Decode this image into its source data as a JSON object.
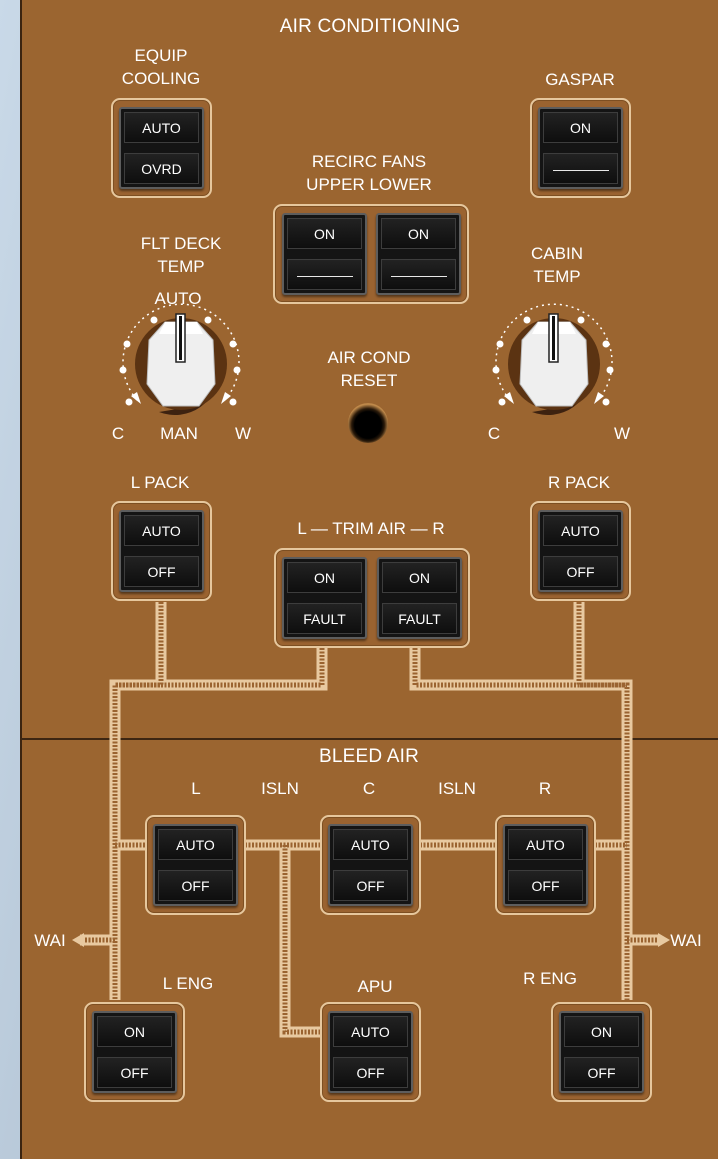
{
  "air_conditioning": {
    "title": "AIR CONDITIONING",
    "equip_cooling": {
      "label": "EQUIP\nCOOLING",
      "top": "AUTO",
      "bottom": "OVRD"
    },
    "gaspar": {
      "label": "GASPAR",
      "top": "ON",
      "bottom": ""
    },
    "recirc_fans": {
      "label": "RECIRC FANS\nUPPER LOWER",
      "upper": {
        "top": "ON",
        "bottom": ""
      },
      "lower": {
        "top": "ON",
        "bottom": ""
      }
    },
    "flt_deck_temp": {
      "label": "FLT DECK\nTEMP",
      "auto": "AUTO",
      "c": "C",
      "man": "MAN",
      "w": "W"
    },
    "cabin_temp": {
      "label": "CABIN\nTEMP",
      "c": "C",
      "w": "W"
    },
    "air_cond_reset": {
      "label": "AIR COND\nRESET"
    },
    "l_pack": {
      "label": "L PACK",
      "top": "AUTO",
      "bottom": "OFF"
    },
    "r_pack": {
      "label": "R PACK",
      "top": "AUTO",
      "bottom": "OFF"
    },
    "trim_air": {
      "label": "L — TRIM AIR — R",
      "left": {
        "top": "ON",
        "bottom": "FAULT"
      },
      "right": {
        "top": "ON",
        "bottom": "FAULT"
      }
    }
  },
  "bleed_air": {
    "title": "BLEED AIR",
    "labels": {
      "l": "L",
      "isln_left": "ISLN",
      "c": "C",
      "isln_right": "ISLN",
      "r": "R"
    },
    "isln_l": {
      "top": "AUTO",
      "bottom": "OFF"
    },
    "isln_c": {
      "top": "AUTO",
      "bottom": "OFF"
    },
    "isln_r": {
      "top": "AUTO",
      "bottom": "OFF"
    },
    "wai_left": "WAI",
    "wai_right": "WAI",
    "l_eng": {
      "label": "L ENG",
      "top": "ON",
      "bottom": "OFF"
    },
    "apu": {
      "label": "APU",
      "top": "AUTO",
      "bottom": "OFF"
    },
    "r_eng": {
      "label": "R ENG",
      "top": "ON",
      "bottom": "OFF"
    }
  }
}
